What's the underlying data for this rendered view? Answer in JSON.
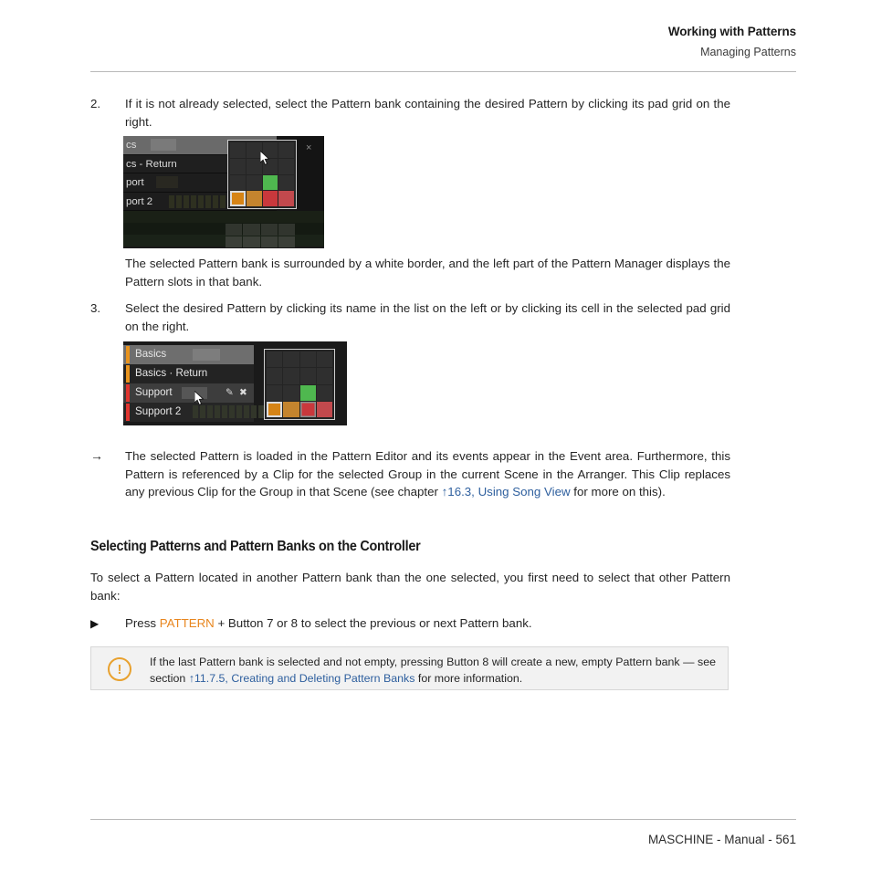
{
  "header": {
    "title": "Working with Patterns",
    "subtitle": "Managing Patterns"
  },
  "steps": [
    {
      "number": "2.",
      "text": "If it is not already selected, select the Pattern bank containing the desired Pattern by clicking its pad grid on the right."
    },
    {
      "number": "3.",
      "text": "Select the desired Pattern by clicking its name in the list on the left or by clicking its cell in the selected pad grid on the right."
    }
  ],
  "caption_after_step2": "The selected Pattern bank is surrounded by a white border, and the left part of the Pattern Manager displays the Pattern slots in that bank.",
  "result_block": {
    "marker": "→",
    "text_before_link": "The selected Pattern is loaded in the Pattern Editor and its events appear in the Event area. Furthermore, this Pattern is referenced by a Clip for the selected Group in the current Scene in the Arranger. This Clip replaces any previous Clip for the Group in that Scene (see chapter ",
    "link": "↑16.3, Using Song View",
    "text_after_link": " for more on this)."
  },
  "section_heading": "Selecting Patterns and Pattern Banks on the Controller",
  "section_intro": "To select a Pattern located in another Pattern bank than the one selected, you first need to select that other Pattern bank:",
  "bullet": {
    "marker": "▶",
    "text_before_keyword": "Press ",
    "keyword": "PATTERN",
    "text_after_keyword": " + Button 7 or 8 to select the previous or next Pattern bank."
  },
  "note": {
    "icon": "!",
    "text_before_link": "If the last Pattern bank is selected and not empty, pressing Button 8 will create a new, empty Pattern bank — see section ",
    "link": "↑11.7.5, Creating and Deleting Pattern Banks",
    "text_after_link": " for more information."
  },
  "footer": {
    "text": "MASCHINE - Manual - 561"
  },
  "screenshot1": {
    "list_rows": [
      {
        "label": "cs"
      },
      {
        "label": "cs - Return"
      },
      {
        "label": "port"
      },
      {
        "label": "port 2"
      }
    ],
    "close_label": "×",
    "pad_grid": {
      "cells": [
        "empty",
        "empty",
        "empty",
        "empty",
        "empty",
        "empty",
        "empty",
        "empty",
        "empty",
        "empty",
        "green",
        "empty",
        "orange-selected",
        "orange2",
        "red",
        "red2"
      ]
    }
  },
  "screenshot2": {
    "list_rows": [
      {
        "label": "Basics",
        "color": "#e8931e",
        "state": "selected"
      },
      {
        "label": "Basics · Return",
        "color": "#e8931e",
        "state": "normal"
      },
      {
        "label": "Support",
        "color": "#e0352f",
        "state": "hover"
      },
      {
        "label": "Support 2",
        "color": "#e0352f",
        "state": "normal"
      }
    ],
    "row_icons": {
      "edit": "✎",
      "delete": "✖"
    },
    "pad_grid": {
      "cells": [
        "empty",
        "empty",
        "empty",
        "empty",
        "empty",
        "empty",
        "empty",
        "empty",
        "empty",
        "empty",
        "green",
        "empty",
        "orange-selected",
        "orange2",
        "red-selected",
        "red2"
      ]
    }
  },
  "colors": {
    "link": "#2e5f9e",
    "keyword": "#e8861e",
    "note_border": "#d7d7d7",
    "note_bg": "#f2f2f2",
    "note_icon": "#e8a12e",
    "pad_green": "#4fb84f",
    "pad_orange": "#d68416",
    "pad_red": "#c9383c"
  }
}
